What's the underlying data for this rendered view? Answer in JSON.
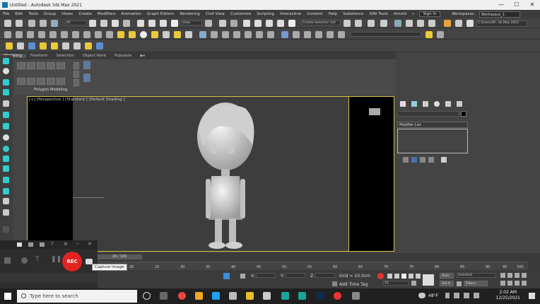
{
  "window": {
    "title": "Untitled - Autodesk 3ds Max 2021"
  },
  "menu": [
    "File",
    "Edit",
    "Tools",
    "Group",
    "Views",
    "Create",
    "Modifiers",
    "Animation",
    "Graph Editors",
    "Rendering",
    "Civil View",
    "Customize",
    "Scripting",
    "Interactive",
    "Content",
    "Help",
    "Substance",
    "SiNi Tools",
    "Arnold"
  ],
  "signin": "Sign In",
  "workspace": {
    "label": "Workspaces:",
    "value": "Workspace_1"
  },
  "toolbar": {
    "filter": "All",
    "view": "View",
    "selection_set": "Create Selection Set",
    "path": "C:\\Users\\M...ds Max 2021"
  },
  "ribbon": {
    "tabs": [
      "Modeling",
      "Freeform",
      "Selection",
      "Object Paint",
      "Populate"
    ],
    "active_tab": "Modeling",
    "panel_label": "Polygon Modeling"
  },
  "viewport": {
    "label": "[+] [Perspective ] [Standard ] [Default Shading ]"
  },
  "command_panel": {
    "modifier_list": "Modifier List"
  },
  "timeline": {
    "slider": "16 / 100",
    "ticks": [
      "20",
      "25",
      "30",
      "35",
      "40",
      "45",
      "50",
      "55",
      "60",
      "65",
      "70",
      "75",
      "80",
      "85",
      "90",
      "95",
      "100"
    ]
  },
  "recorder": {
    "rec": "REC",
    "tooltip": "Capture Image"
  },
  "status": {
    "x_label": "X:",
    "y_label": "Y:",
    "z_label": "Z:",
    "grid": "Grid = 10.0cm",
    "add_time_tag": "Add Time Tag",
    "frame": "16",
    "auto": "Auto",
    "set_k": "Set K.",
    "selected": "Selected",
    "filters": "Filters..."
  },
  "taskbar": {
    "search_placeholder": "Type here to search",
    "weather": "48°F",
    "time": "2:02 AM",
    "date": "12/25/2021"
  },
  "colors": {
    "accent": "#d9c33a",
    "rec": "#e32222",
    "viewport_bg": "#3d3d3d"
  }
}
